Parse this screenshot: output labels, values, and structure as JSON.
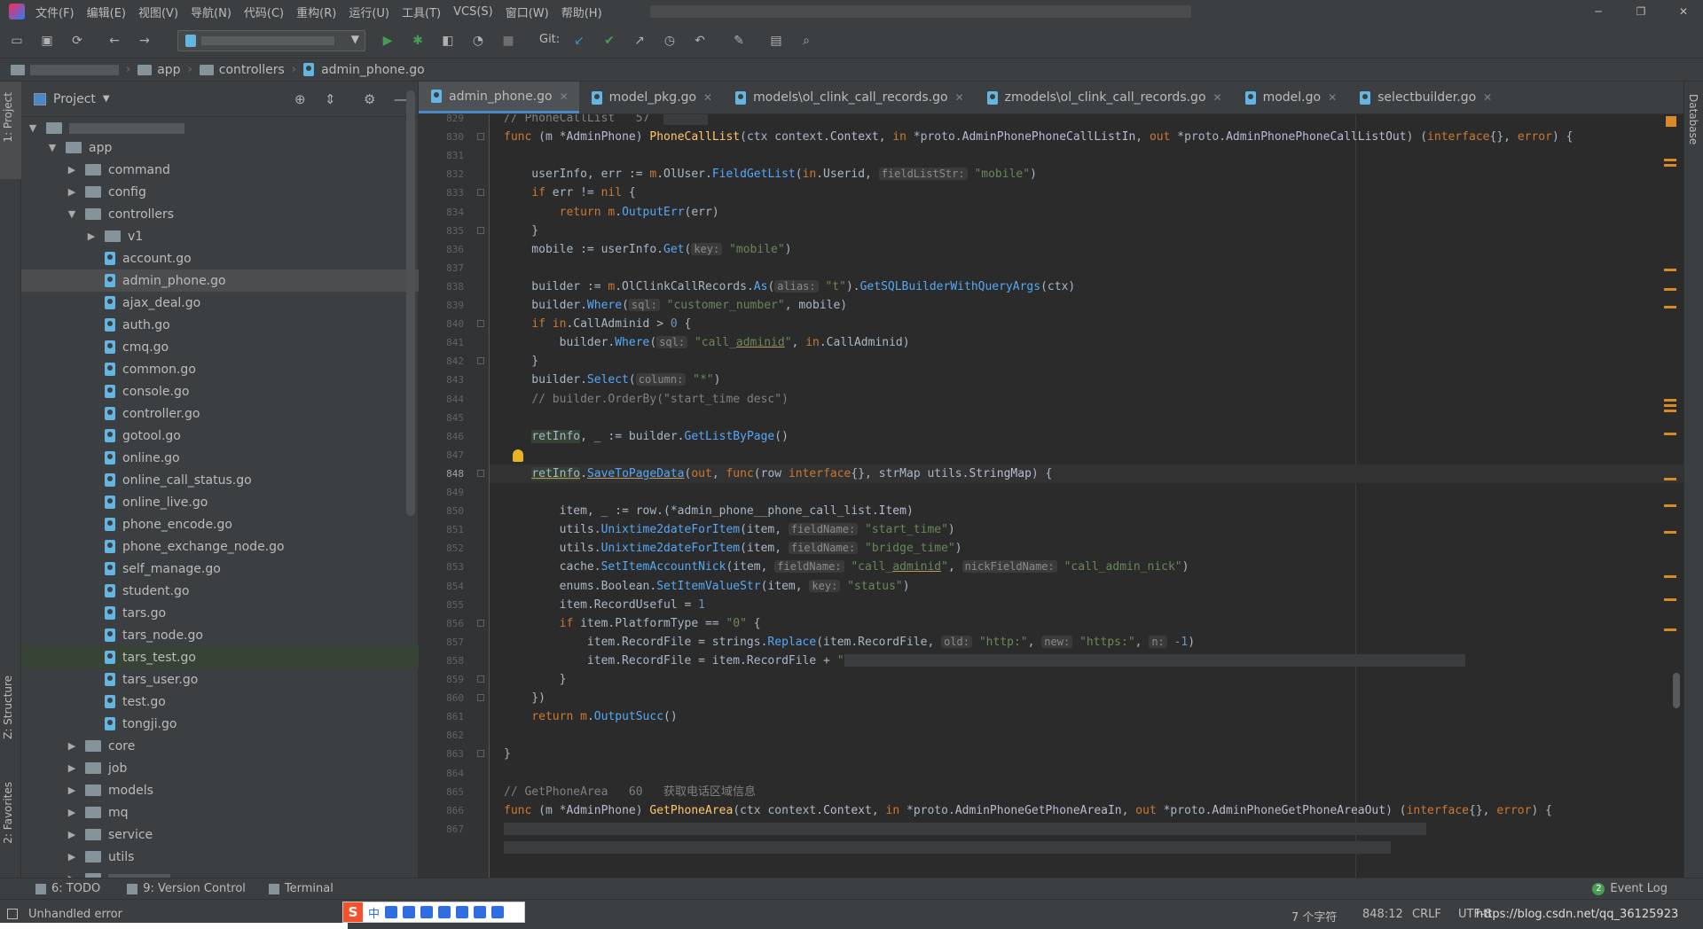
{
  "menu": [
    "文件(F)",
    "编辑(E)",
    "视图(V)",
    "导航(N)",
    "代码(C)",
    "重构(R)",
    "运行(U)",
    "工具(T)",
    "VCS(S)",
    "窗口(W)",
    "帮助(H)"
  ],
  "toolbar": {
    "git_label": "Git:"
  },
  "breadcrumb": [
    "app",
    "controllers",
    "admin_phone.go"
  ],
  "project_panel": {
    "title": "Project"
  },
  "left_strip": {
    "project": "1: Project",
    "structure": "Z: Structure",
    "favorites": "2: Favorites"
  },
  "right_strip": {
    "database": "Database"
  },
  "tree": [
    {
      "name": "app",
      "type": "folder",
      "depth": 1,
      "expanded": true
    },
    {
      "name": "command",
      "type": "folder",
      "depth": 2,
      "expanded": false
    },
    {
      "name": "config",
      "type": "folder",
      "depth": 2,
      "expanded": false
    },
    {
      "name": "controllers",
      "type": "folder",
      "depth": 2,
      "expanded": true
    },
    {
      "name": "v1",
      "type": "folder",
      "depth": 3,
      "expanded": false
    },
    {
      "name": "account.go",
      "type": "file",
      "depth": 3
    },
    {
      "name": "admin_phone.go",
      "type": "file",
      "depth": 3,
      "state": "selected"
    },
    {
      "name": "ajax_deal.go",
      "type": "file",
      "depth": 3
    },
    {
      "name": "auth.go",
      "type": "file",
      "depth": 3
    },
    {
      "name": "cmq.go",
      "type": "file",
      "depth": 3
    },
    {
      "name": "common.go",
      "type": "file",
      "depth": 3
    },
    {
      "name": "console.go",
      "type": "file",
      "depth": 3
    },
    {
      "name": "controller.go",
      "type": "file",
      "depth": 3
    },
    {
      "name": "gotool.go",
      "type": "file",
      "depth": 3
    },
    {
      "name": "online.go",
      "type": "file",
      "depth": 3
    },
    {
      "name": "online_call_status.go",
      "type": "file",
      "depth": 3
    },
    {
      "name": "online_live.go",
      "type": "file",
      "depth": 3
    },
    {
      "name": "phone_encode.go",
      "type": "file",
      "depth": 3
    },
    {
      "name": "phone_exchange_node.go",
      "type": "file",
      "depth": 3
    },
    {
      "name": "self_manage.go",
      "type": "file",
      "depth": 3
    },
    {
      "name": "student.go",
      "type": "file",
      "depth": 3
    },
    {
      "name": "tars.go",
      "type": "file",
      "depth": 3
    },
    {
      "name": "tars_node.go",
      "type": "file",
      "depth": 3
    },
    {
      "name": "tars_test.go",
      "type": "file",
      "depth": 3,
      "state": "highlight"
    },
    {
      "name": "tars_user.go",
      "type": "file",
      "depth": 3
    },
    {
      "name": "test.go",
      "type": "file",
      "depth": 3
    },
    {
      "name": "tongji.go",
      "type": "file",
      "depth": 3
    },
    {
      "name": "core",
      "type": "folder",
      "depth": 2,
      "expanded": false
    },
    {
      "name": "job",
      "type": "folder",
      "depth": 2,
      "expanded": false
    },
    {
      "name": "models",
      "type": "folder",
      "depth": 2,
      "expanded": false
    },
    {
      "name": "mq",
      "type": "folder",
      "depth": 2,
      "expanded": false
    },
    {
      "name": "service",
      "type": "folder",
      "depth": 2,
      "expanded": false
    },
    {
      "name": "utils",
      "type": "folder",
      "depth": 2,
      "expanded": false
    }
  ],
  "tabs": [
    {
      "label": "admin_phone.go",
      "active": true
    },
    {
      "label": "model_pkg.go",
      "active": false
    },
    {
      "label": "models\\ol_clink_call_records.go",
      "active": false
    },
    {
      "label": "zmodels\\ol_clink_call_records.go",
      "active": false
    },
    {
      "label": "model.go",
      "active": false
    },
    {
      "label": "selectbuilder.go",
      "active": false
    }
  ],
  "editor": {
    "line_numbers": [
      "829",
      "830",
      "831",
      "832",
      "833",
      "834",
      "835",
      "836",
      "837",
      "838",
      "839",
      "840",
      "841",
      "842",
      "843",
      "844",
      "845",
      "846",
      "847",
      "848",
      "849",
      "850",
      "851",
      "852",
      "853",
      "854",
      "855",
      "856",
      "857",
      "858",
      "859",
      "860",
      "861",
      "862",
      "863",
      "864",
      "865",
      "866",
      "867"
    ],
    "current_line": "848"
  },
  "bottom_tabs": [
    "6: TODO",
    "9: Version Control",
    "Terminal"
  ],
  "event_log": {
    "label": "Event Log",
    "count": "2"
  },
  "status": {
    "message": "Unhandled error",
    "chars": "7 个字符",
    "position": "848:12",
    "line_sep": "CRLF",
    "encoding": "UTF-8",
    "watermark": "https://blog.csdn.net/qq_36125923"
  },
  "ime": {
    "icon": "S",
    "lang": "中"
  },
  "colors": {
    "accent": "#4a88c7",
    "keyword": "#cc7832",
    "function": "#ffc66d",
    "string": "#6a8759",
    "number": "#6897bb",
    "marker": "#d98a28"
  }
}
